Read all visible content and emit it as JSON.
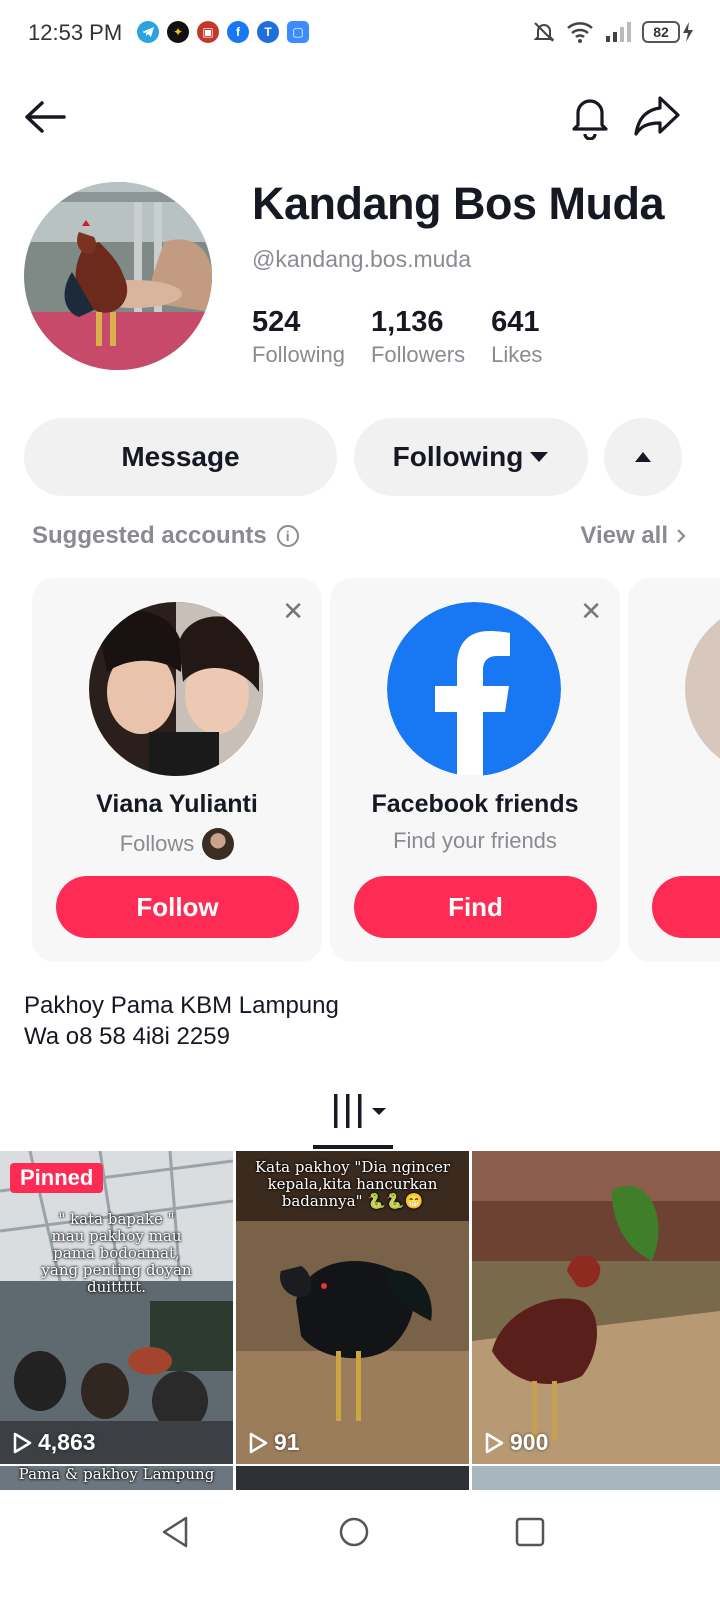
{
  "status_bar": {
    "time": "12:53 PM",
    "battery": "82",
    "notification_icons": [
      "telegram-icon",
      "app-icon",
      "app-icon",
      "facebook-icon",
      "app-icon",
      "app-icon"
    ]
  },
  "profile": {
    "name": "Kandang Bos Muda",
    "handle": "@kandang.bos.muda",
    "stats": [
      {
        "value": "524",
        "label": "Following"
      },
      {
        "value": "1,136",
        "label": "Followers"
      },
      {
        "value": "641",
        "label": "Likes"
      }
    ],
    "bio_line1": "Pakhoy Pama KBM Lampung",
    "bio_line2": "Wa o8 58 4i8i 2259"
  },
  "actions": {
    "message": "Message",
    "following": "Following"
  },
  "suggested": {
    "title": "Suggested accounts",
    "view_all": "View all",
    "cards": [
      {
        "name": "Viana Yulianti",
        "sub": "Follows",
        "button": "Follow"
      },
      {
        "name": "Facebook friends",
        "sub": "Find your friends",
        "button": "Find"
      }
    ]
  },
  "videos": [
    {
      "pinned": "Pinned",
      "caption": "\" kata bapake \" mau pakhoy mau pama bodoamat, yang penting doyan duittttt.",
      "views": "4,863"
    },
    {
      "caption": "Kata pakhoy \"Dia ngincer kepala,kita hancurkan badannya\" 🐍🐍😁",
      "views": "91"
    },
    {
      "caption": "",
      "views": "900"
    }
  ],
  "row2_caption": "Pama & pakhoy Lampung",
  "colors": {
    "accent": "#fe2c55",
    "pill_bg": "#f1f1f2",
    "secondary_text": "#8a8b91",
    "facebook_blue": "#1877f2"
  }
}
